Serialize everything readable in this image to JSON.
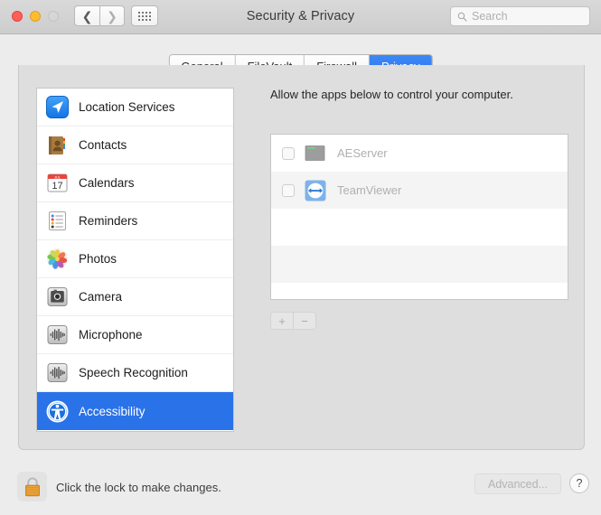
{
  "window": {
    "title": "Security & Privacy",
    "traffic_lights": [
      {
        "name": "close",
        "color": "#ff5f57",
        "enabled": true
      },
      {
        "name": "minimize",
        "color": "#febc2e",
        "enabled": true
      },
      {
        "name": "zoom",
        "color": "#d6d6d6",
        "enabled": false
      }
    ],
    "nav": {
      "back_icon": "chevron-left-icon",
      "forward_icon": "chevron-right-icon",
      "grid_icon": "grid-view-icon"
    }
  },
  "search": {
    "placeholder": "Search",
    "value": "",
    "icon": "search-icon"
  },
  "tabs": [
    {
      "label": "General",
      "selected": false
    },
    {
      "label": "FileVault",
      "selected": false
    },
    {
      "label": "Firewall",
      "selected": false
    },
    {
      "label": "Privacy",
      "selected": true
    }
  ],
  "sidebar": {
    "items": [
      {
        "label": "Location Services",
        "icon": "location-services-icon",
        "selected": false
      },
      {
        "label": "Contacts",
        "icon": "contacts-icon",
        "selected": false
      },
      {
        "label": "Calendars",
        "icon": "calendar-icon",
        "selected": false,
        "day": "17"
      },
      {
        "label": "Reminders",
        "icon": "reminders-icon",
        "selected": false
      },
      {
        "label": "Photos",
        "icon": "photos-icon",
        "selected": false
      },
      {
        "label": "Camera",
        "icon": "camera-icon",
        "selected": false
      },
      {
        "label": "Microphone",
        "icon": "microphone-icon",
        "selected": false
      },
      {
        "label": "Speech Recognition",
        "icon": "speech-recognition-icon",
        "selected": false
      },
      {
        "label": "Accessibility",
        "icon": "accessibility-icon",
        "selected": true
      }
    ]
  },
  "main": {
    "caption": "Allow the apps below to control your computer.",
    "app_list": [
      {
        "name": "AEServer",
        "icon": "aeserver-icon",
        "checked": false,
        "disabled": true
      },
      {
        "name": "TeamViewer",
        "icon": "teamviewer-icon",
        "checked": false,
        "disabled": true
      }
    ],
    "empty_rows": 3,
    "add_button_label": "+",
    "remove_button_label": "−"
  },
  "bottom": {
    "lock_icon": "lock-closed-icon",
    "lock_text": "Click the lock to make changes.",
    "advanced_label": "Advanced...",
    "advanced_enabled": false,
    "help_label": "?"
  },
  "colors": {
    "accent": "#2a72e8",
    "tab_selected": "#3d88f5",
    "window_bg": "#ececec",
    "panel_bg": "#dedede",
    "list_bg": "#ffffff",
    "row_alt": "#f4f4f4",
    "disabled_text": "#b0b0b0"
  }
}
